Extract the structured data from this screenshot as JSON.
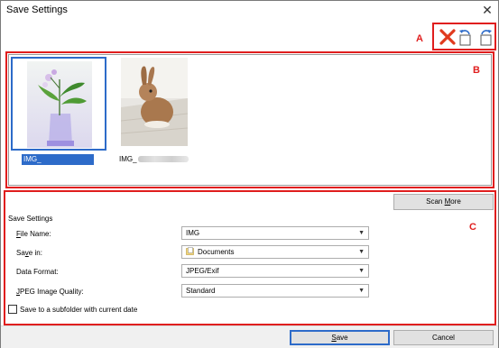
{
  "window": {
    "title": "Save Settings",
    "close_glyph": "✕"
  },
  "annotations": {
    "a": "A",
    "b": "B",
    "c": "C"
  },
  "toolbar": {
    "delete_icon": "delete-icon",
    "rotate_left_icon": "rotate-left-icon",
    "rotate_right_icon": "rotate-right-icon"
  },
  "thumbnails": [
    {
      "name": "IMG_",
      "selected": true,
      "subject": "flowers in glass vase"
    },
    {
      "name": "IMG_",
      "selected": false,
      "subject": "rabbit"
    }
  ],
  "scan_more": {
    "label_pre": "Scan ",
    "label_key": "M",
    "label_post": "ore"
  },
  "settings": {
    "heading": "Save Settings",
    "file_name": {
      "label_key": "F",
      "label_post": "ile Name:",
      "value": "IMG"
    },
    "save_in": {
      "label_pre": "Sa",
      "label_key": "v",
      "label_post": "e in:",
      "value": "Documents"
    },
    "data_format": {
      "label": "Data Format:",
      "value": "JPEG/Exif"
    },
    "jpeg_quality": {
      "label_key": "J",
      "label_post": "PEG Image Quality:",
      "value": "Standard"
    },
    "subfolder": {
      "label": "Save to a subfolder with current date",
      "checked": false
    }
  },
  "buttons": {
    "save": {
      "label_key": "S",
      "label_post": "ave"
    },
    "cancel": {
      "label": "Cancel"
    }
  },
  "colors": {
    "annotation_red": "#e01e1e",
    "selection_blue": "#2d6bc9"
  }
}
